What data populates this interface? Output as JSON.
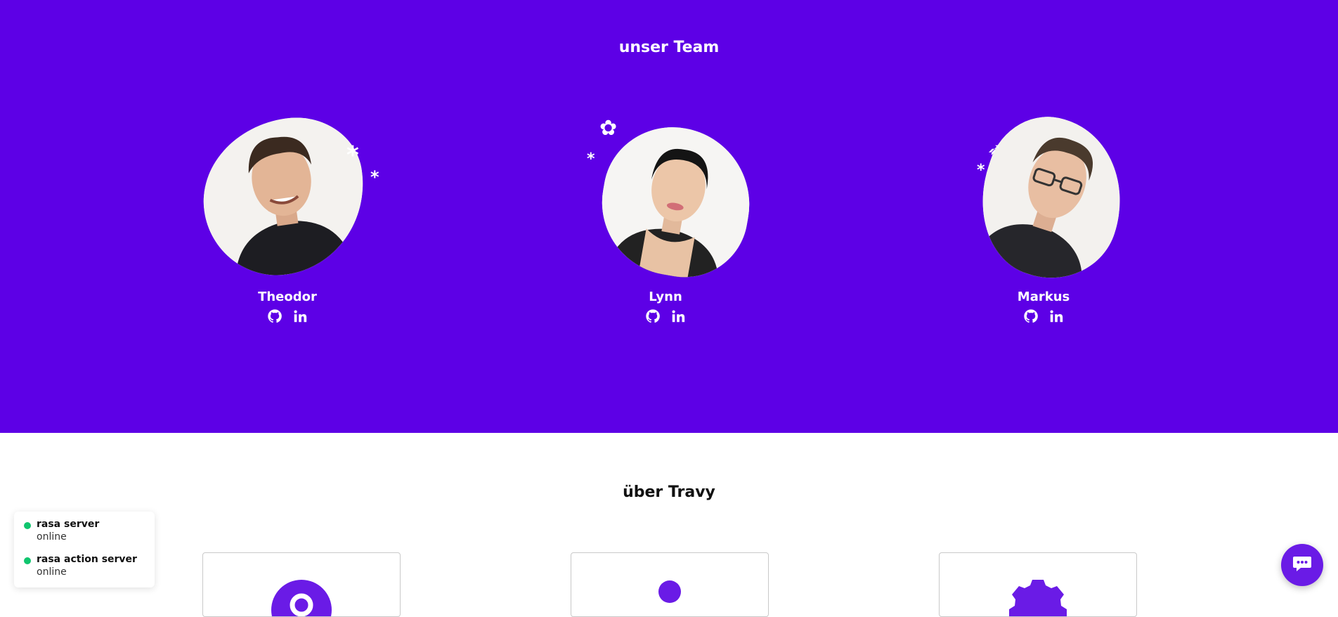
{
  "team": {
    "title": "unser Team",
    "members": [
      {
        "name": "Theodor",
        "github_icon": "github-icon",
        "linkedin_icon": "linkedin-icon"
      },
      {
        "name": "Lynn",
        "github_icon": "github-icon",
        "linkedin_icon": "linkedin-icon"
      },
      {
        "name": "Markus",
        "github_icon": "github-icon",
        "linkedin_icon": "linkedin-icon"
      }
    ],
    "background_color": "#5d00e6"
  },
  "about": {
    "title": "über Travy",
    "cards": [
      {
        "icon": "location-pin-icon"
      },
      {
        "icon": "person-icon"
      },
      {
        "icon": "gear-icon"
      }
    ]
  },
  "status": {
    "items": [
      {
        "name": "rasa server",
        "state": "online",
        "color": "#10c56e"
      },
      {
        "name": "rasa action server",
        "state": "online",
        "color": "#10c56e"
      }
    ]
  },
  "chat": {
    "icon": "chat-bubble-icon",
    "color": "#6a1be6"
  }
}
